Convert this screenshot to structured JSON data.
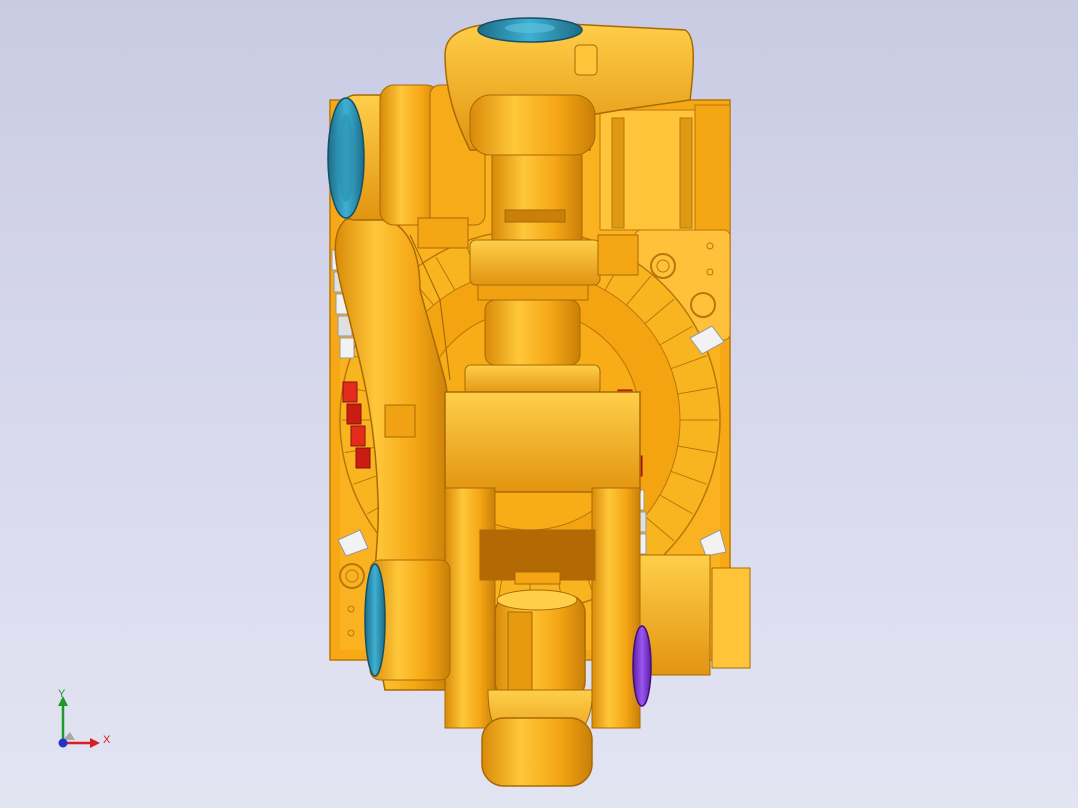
{
  "scene": {
    "subject": "robot-arm-cad-model",
    "colors": {
      "background_top": "#c9cbe3",
      "background_bottom": "#e3e4f2",
      "body_orange": "#f5a614",
      "body_light": "#ffc73a",
      "body_shadow": "#c97f08",
      "highlight": "#ffe27a",
      "cap_blue": "#2a8fb0",
      "cap_purple": "#7a2fd6",
      "accent_red": "#e42b1c",
      "accent_white": "#f2f2f2"
    }
  },
  "triad": {
    "x_label": "X",
    "y_label": "Y",
    "x_color": "#d42020",
    "y_color": "#1f9a2a",
    "z_color": "#2233cc"
  }
}
